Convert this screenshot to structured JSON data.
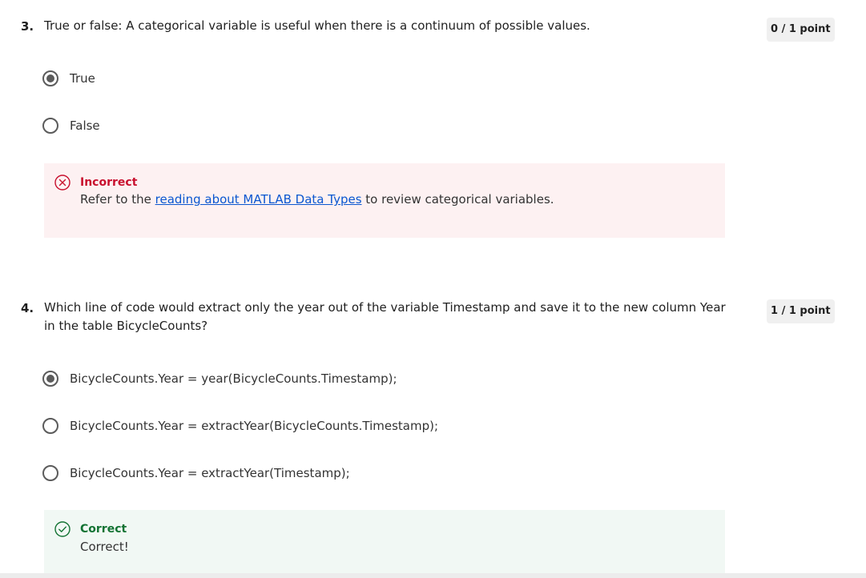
{
  "questions": [
    {
      "number": "3.",
      "text": "True or false: A categorical variable is useful when there is a continuum of possible values.",
      "points": "0 / 1 point",
      "options": [
        {
          "label": "True",
          "selected": true
        },
        {
          "label": "False",
          "selected": false
        }
      ],
      "feedback": {
        "status": "Incorrect",
        "body_before": "Refer to the ",
        "link_text": "reading about MATLAB Data Types",
        "body_after": " to review categorical variables.",
        "icon": "x-circle-icon",
        "color": "#c8102e"
      }
    },
    {
      "number": "4.",
      "text": "Which line of code would extract only the year out of the variable Timestamp and save it to the new column Year in the table BicycleCounts?",
      "points": "1 / 1 point",
      "options": [
        {
          "label": "BicycleCounts.Year = year(BicycleCounts.Timestamp);",
          "selected": true
        },
        {
          "label": "BicycleCounts.Year = extractYear(BicycleCounts.Timestamp);",
          "selected": false
        },
        {
          "label": "BicycleCounts.Year = extractYear(Timestamp);",
          "selected": false
        }
      ],
      "feedback": {
        "status": "Correct",
        "body": "Correct!",
        "icon": "check-circle-icon",
        "color": "#137333"
      }
    }
  ]
}
